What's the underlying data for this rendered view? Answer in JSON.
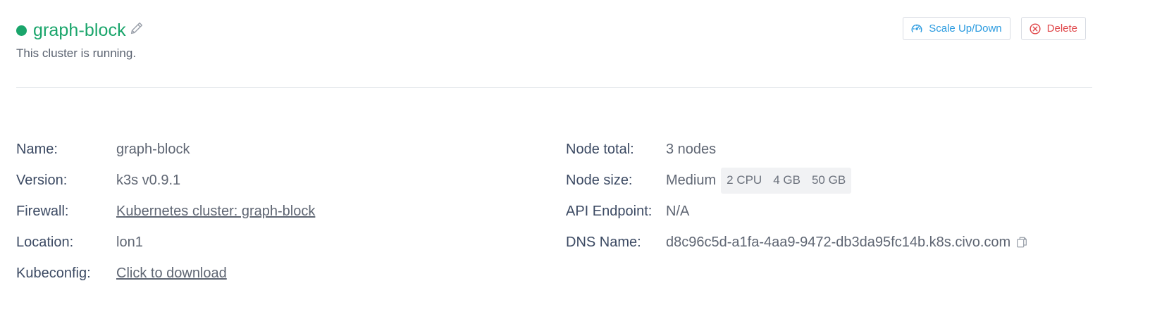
{
  "header": {
    "cluster_name": "graph-block",
    "status_text": "This cluster is running.",
    "status_color": "#1aa56b"
  },
  "actions": {
    "scale_label": "Scale Up/Down",
    "delete_label": "Delete"
  },
  "details_left": {
    "name_label": "Name:",
    "name_value": "graph-block",
    "version_label": "Version:",
    "version_value": "k3s v0.9.1",
    "firewall_label": "Firewall:",
    "firewall_value": "Kubernetes cluster: graph-block",
    "location_label": "Location:",
    "location_value": "lon1",
    "kubeconfig_label": "Kubeconfig:",
    "kubeconfig_value": "Click to download"
  },
  "details_right": {
    "node_total_label": "Node total:",
    "node_total_value": "3 nodes",
    "node_size_label": "Node size:",
    "node_size_value": "Medium",
    "node_size_specs": [
      "2 CPU",
      "4 GB",
      "50 GB"
    ],
    "api_endpoint_label": "API Endpoint:",
    "api_endpoint_value": "N/A",
    "dns_name_label": "DNS Name:",
    "dns_name_value": "d8c96c5d-a1fa-4aa9-9472-db3da95fc14b.k8s.civo.com"
  },
  "icons": {
    "status": "status-dot-icon",
    "edit": "pencil-icon",
    "scale": "gauge-icon",
    "delete": "circle-x-icon",
    "copy": "copy-icon"
  },
  "colors": {
    "accent_blue": "#2b9be0",
    "danger_red": "#e0484b",
    "running_green": "#1aa56b"
  }
}
